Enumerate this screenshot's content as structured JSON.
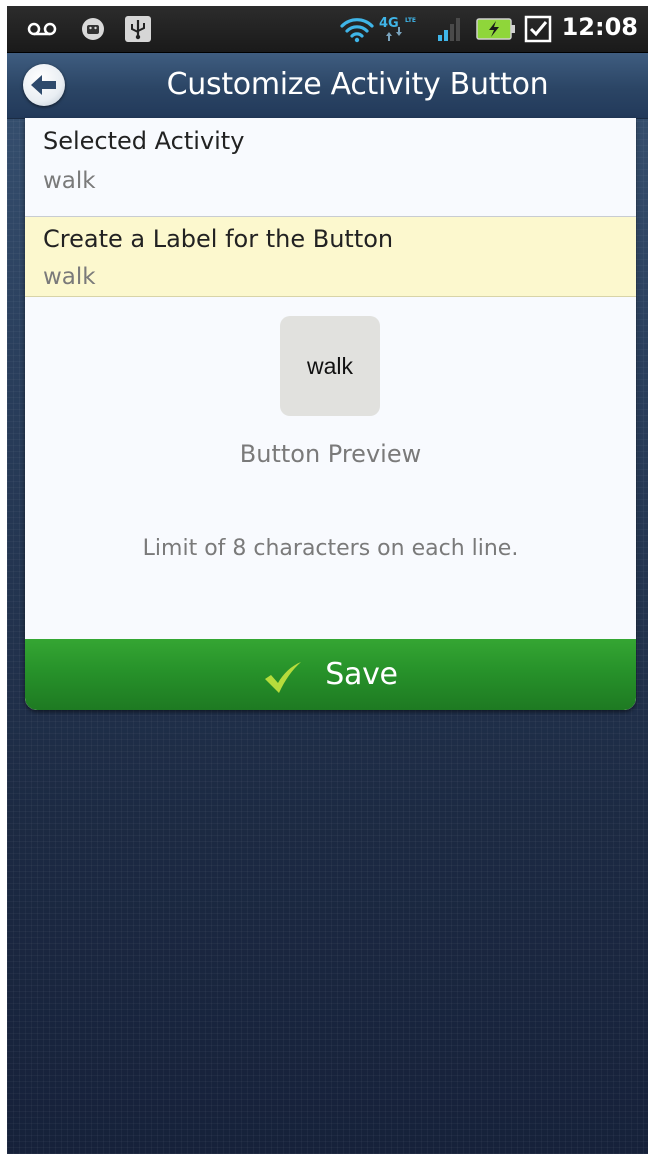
{
  "status_bar": {
    "time": "12:08",
    "network_label": "4G LTE",
    "icons": [
      "voicemail-icon",
      "android-debug-icon",
      "usb-icon",
      "wifi-icon",
      "4g-lte-icon",
      "signal-icon",
      "battery-charging-icon",
      "task-check-icon"
    ]
  },
  "header": {
    "title": "Customize Activity Button",
    "back_icon": "back-arrow-icon"
  },
  "form": {
    "selected_activity_label": "Selected Activity",
    "selected_activity_value": "walk",
    "button_label_title": "Create a Label for the Button",
    "button_label_value": "walk"
  },
  "preview": {
    "button_text": "walk",
    "caption": "Button Preview",
    "limit_note": "Limit of 8 characters on each line."
  },
  "actions": {
    "save_label": "Save",
    "save_icon": "checkmark-icon"
  },
  "colors": {
    "header_blue": "#2b4565",
    "highlight_row": "#fcf8ce",
    "save_green": "#27922a"
  }
}
